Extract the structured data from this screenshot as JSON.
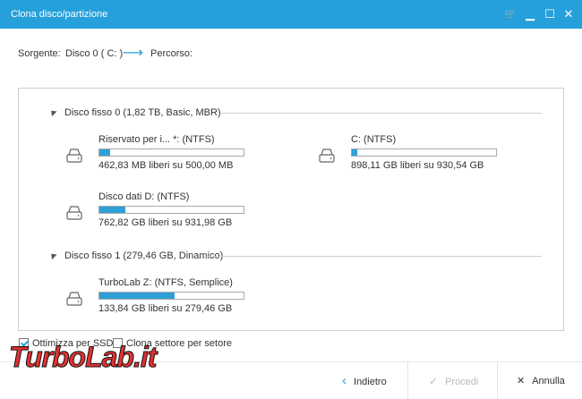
{
  "window": {
    "title": "Clona disco/partizione",
    "controls": {
      "cart": "🛒",
      "minimize": "▁",
      "maximize": "☐",
      "close": "✕"
    }
  },
  "source_bar": {
    "source_label": "Sorgente:",
    "source_value": "Disco 0 ( C: )",
    "arrow": "⟶",
    "target_label": "Percorso:"
  },
  "disks": [
    {
      "header": "Disco fisso 0 (1,82 TB, Basic, MBR)",
      "partitions": [
        {
          "name": "Riservato per i... *: (NTFS)",
          "used_fraction": 0.075,
          "free": "462,83 MB liberi su 500,00 MB"
        },
        {
          "name": "C: (NTFS)",
          "used_fraction": 0.035,
          "free": "898,11 GB liberi su 930,54 GB"
        },
        {
          "name": "Disco dati D: (NTFS)",
          "used_fraction": 0.18,
          "free": "762,82 GB liberi su 931,98 GB"
        }
      ]
    },
    {
      "header": "Disco fisso 1 (279,46 GB, Dinamico)",
      "partitions": [
        {
          "name": "TurboLab Z: (NTFS, Semplice)",
          "used_fraction": 0.52,
          "free": "133,84 GB liberi su 279,46 GB"
        }
      ]
    }
  ],
  "options": {
    "optimize_ssd": {
      "label": "Ottimizza per SSD",
      "checked": true
    },
    "sector_clone": {
      "label": "Clona settore per setore",
      "checked": false
    }
  },
  "footer": {
    "back": {
      "label": "Indietro",
      "icon": "‹"
    },
    "proceed": {
      "label": "Procedi",
      "icon": "✓",
      "enabled": false
    },
    "cancel": {
      "label": "Annulla",
      "icon": "✕"
    }
  },
  "watermark": "TurboLab.it",
  "colors": {
    "accent": "#26a0da",
    "bar_fill": "#2f9fd8",
    "watermark": "#e02020"
  }
}
